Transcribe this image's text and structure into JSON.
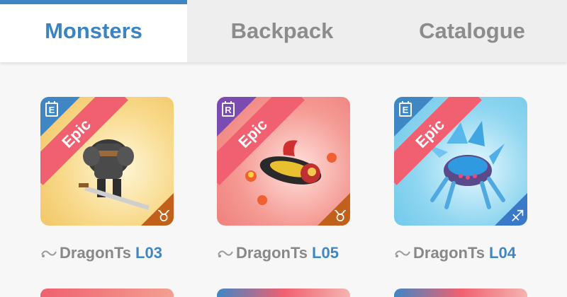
{
  "tabs": [
    {
      "label": "Monsters",
      "active": true
    },
    {
      "label": "Backpack",
      "active": false
    },
    {
      "label": "Catalogue",
      "active": false
    }
  ],
  "cards": [
    {
      "rarity": "Epic",
      "grade": "E",
      "sign_icon": "taurus-icon",
      "sign_glyph": "♉",
      "owner": "DragonTs",
      "level": "L03",
      "bg": "#f8d98a",
      "sign_color": "#c0601a",
      "monster": "armored-knight"
    },
    {
      "rarity": "Epic",
      "grade": "R",
      "sign_icon": "taurus-icon",
      "sign_glyph": "♉",
      "owner": "DragonTs",
      "level": "L05",
      "bg": "#f27f7c",
      "sign_color": "#c0601a",
      "monster": "fire-bird"
    },
    {
      "rarity": "Epic",
      "grade": "E",
      "sign_icon": "sagittarius-icon",
      "sign_glyph": "♐",
      "owner": "DragonTs",
      "level": "L04",
      "bg": "#7fd0ee",
      "sign_color": "#3a78c8",
      "monster": "ice-spider"
    }
  ],
  "colors": {
    "accent": "#3f86c4",
    "ribbon": "#f06070",
    "grade_e": "#3f86c4",
    "grade_r": "#7a4bb0"
  }
}
